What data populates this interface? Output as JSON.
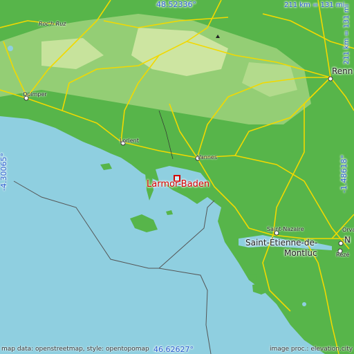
{
  "map": {
    "place_label": "Larmor-Baden",
    "coords": {
      "top": "48.52336°",
      "bottom": "46.62627°",
      "left": "-4.30065°",
      "right": "-1.48618°"
    },
    "scale": {
      "horizontal": "211 km = 131 mi",
      "vertical": "211 km = 131 mi"
    },
    "cities": {
      "roc_h_ruz": "Roc'h Ruz",
      "quimper": "Quimper",
      "lorient": "Lorient",
      "vannes": "Vannes",
      "rennes": "Renn",
      "saint_nazaire": "Saint-Nazaire",
      "saint_etienne_1": "Saint-Étienne-de-",
      "saint_etienne_2": "Montluc",
      "orvault": "Orva",
      "nantes": "N",
      "reze": "Rezé"
    },
    "credits": {
      "left": "map data: openstreetmap, style: opentopomap",
      "right": "image proc.: elevation.city"
    },
    "colors": {
      "sea": "#8fcfe0",
      "lowland": "#57b54a",
      "upland": "#9fd27d",
      "highland": "#d3e8a6",
      "roads": "#f2d900",
      "label_blue": "#2a5fd0",
      "focus_red": "#d40000"
    }
  }
}
